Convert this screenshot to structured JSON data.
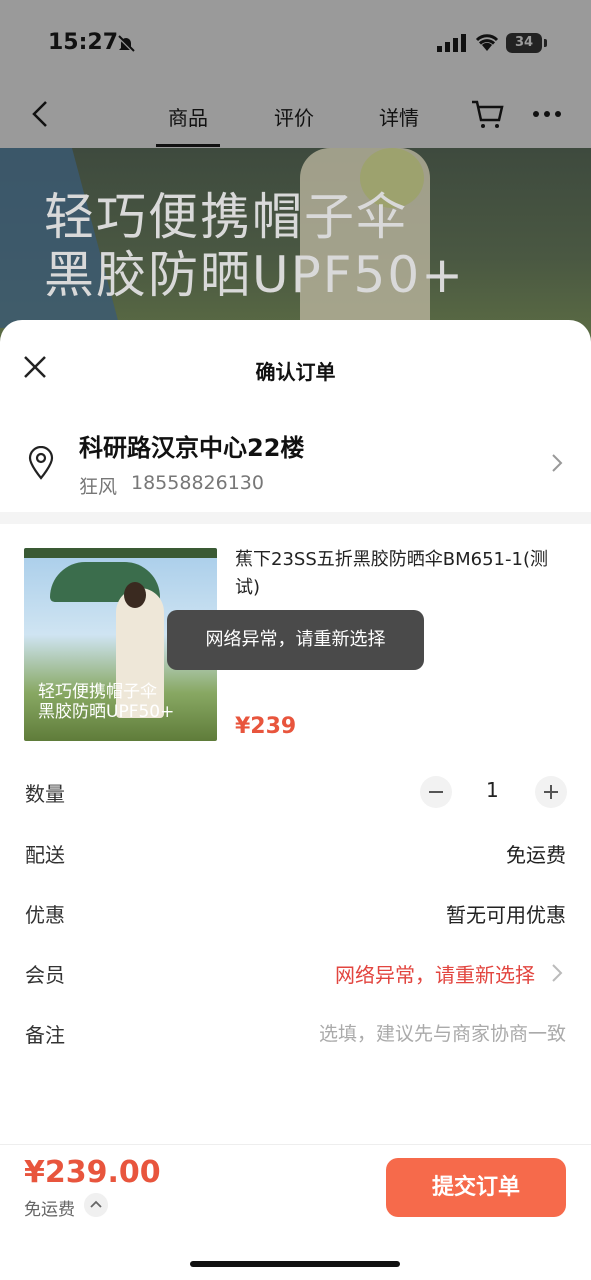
{
  "status": {
    "time": "15:27",
    "battery": "34"
  },
  "nav": {
    "tabs": [
      "商品",
      "评价",
      "详情"
    ]
  },
  "banner": {
    "line1": "轻巧便携帽子伞",
    "line2": "黑胶防晒UPF50+"
  },
  "sheet": {
    "title": "确认订单"
  },
  "address": {
    "main": "科研路汉京中心22楼",
    "name": "狂风",
    "phone": "18558826130"
  },
  "product": {
    "title": "蕉下23SS五折黑胶防晒伞BM651-1(测试)",
    "price": "¥239",
    "image_text_line1": "轻巧便携帽子伞",
    "image_text_line2": "黑胶防晒UPF50+"
  },
  "toast": {
    "text": "网络异常，请重新选择"
  },
  "rows": {
    "quantity": {
      "label": "数量",
      "value": "1"
    },
    "delivery": {
      "label": "配送",
      "value": "免运费"
    },
    "coupon": {
      "label": "优惠",
      "value": "暂无可用优惠"
    },
    "member": {
      "label": "会员",
      "value": "网络异常，请重新选择"
    },
    "note": {
      "label": "备注",
      "placeholder": "选填，建议先与商家协商一致"
    }
  },
  "footer": {
    "total": "¥239.00",
    "shipping": "免运费",
    "submit_label": "提交订单"
  },
  "colors": {
    "accent": "#f66a4b",
    "price": "#e8553d",
    "error": "#e2453f"
  }
}
